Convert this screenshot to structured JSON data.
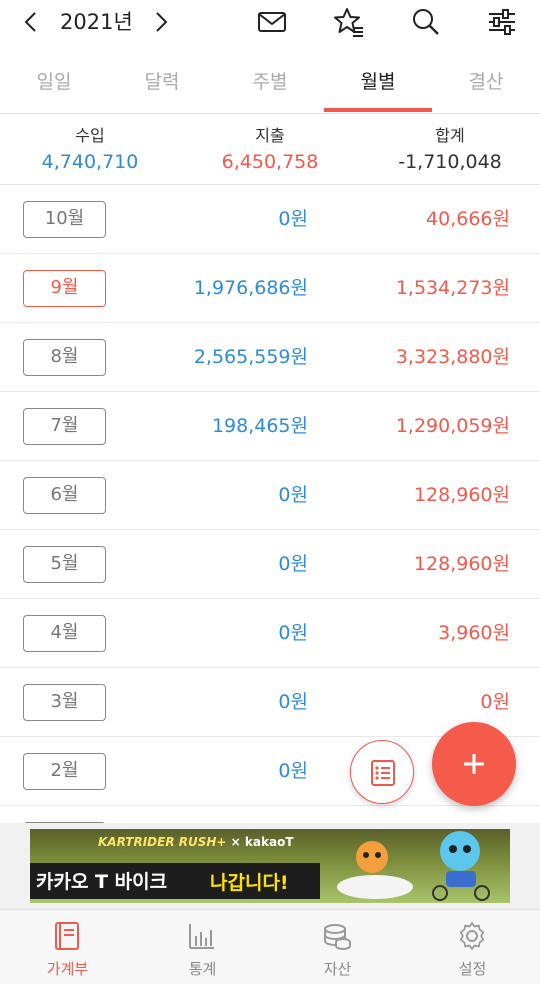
{
  "header": {
    "year": "2021년",
    "icons": [
      "chevron-left-icon",
      "chevron-right-icon",
      "mail-icon",
      "star-list-icon",
      "search-icon",
      "sliders-icon"
    ]
  },
  "tabs": [
    {
      "label": "일일",
      "active": false
    },
    {
      "label": "달력",
      "active": false
    },
    {
      "label": "주별",
      "active": false
    },
    {
      "label": "월별",
      "active": true
    },
    {
      "label": "결산",
      "active": false
    }
  ],
  "summary": {
    "income_label": "수입",
    "income_value": "4,740,710",
    "expense_label": "지출",
    "expense_value": "6,450,758",
    "total_label": "합계",
    "total_value": "-1,710,048"
  },
  "months": [
    {
      "month": "10월",
      "income": "0원",
      "expense": "40,666원",
      "current": false
    },
    {
      "month": "9월",
      "income": "1,976,686원",
      "expense": "1,534,273원",
      "current": true
    },
    {
      "month": "8월",
      "income": "2,565,559원",
      "expense": "3,323,880원",
      "current": false
    },
    {
      "month": "7월",
      "income": "198,465원",
      "expense": "1,290,059원",
      "current": false
    },
    {
      "month": "6월",
      "income": "0원",
      "expense": "128,960원",
      "current": false
    },
    {
      "month": "5월",
      "income": "0원",
      "expense": "128,960원",
      "current": false
    },
    {
      "month": "4월",
      "income": "0원",
      "expense": "3,960원",
      "current": false
    },
    {
      "month": "3월",
      "income": "0원",
      "expense": "0원",
      "current": false
    },
    {
      "month": "2월",
      "income": "0원",
      "expense": "",
      "current": false
    }
  ],
  "ad": {
    "brand_game": "KARTRIDER RUSH+",
    "brand_x": "×",
    "brand_partner": "kakaoT",
    "headline": "카카오 T 바이크",
    "tagline": "나갑니다!"
  },
  "bottom_nav": [
    {
      "label": "가계부",
      "icon": "book-icon",
      "active": true
    },
    {
      "label": "통계",
      "icon": "bar-chart-icon",
      "active": false
    },
    {
      "label": "자산",
      "icon": "coins-icon",
      "active": false
    },
    {
      "label": "설정",
      "icon": "gear-icon",
      "active": false
    }
  ],
  "colors": {
    "accent": "#f15a4a",
    "income": "#2e8bd8",
    "expense": "#f15a4a"
  }
}
